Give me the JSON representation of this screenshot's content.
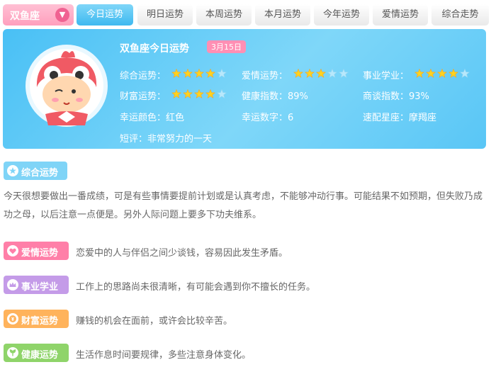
{
  "nav": {
    "sign": "双鱼座",
    "tabs": [
      "今日运势",
      "明日运势",
      "本周运势",
      "本月运势",
      "今年运势",
      "爱情运势",
      "综合走势"
    ]
  },
  "banner": {
    "title": "双鱼座今日运势",
    "date": "3月15日",
    "stats": {
      "overall": {
        "label": "综合运势：",
        "stars": 4
      },
      "love": {
        "label": "爱情运势：",
        "stars": 3
      },
      "career": {
        "label": "事业学业：",
        "stars": 4
      },
      "wealth": {
        "label": "财富运势：",
        "stars": 4
      },
      "health": "健康指数：89%",
      "negotiation": "商谈指数：93%",
      "color": "幸运颜色：红色",
      "number": "幸运数字：6",
      "match": "速配星座：摩羯座",
      "comment": "短评：非常努力的一天"
    }
  },
  "sections": {
    "overall": {
      "label": "综合运势",
      "text": "今天很想要做出一番成绩，可是有些事情要提前计划或是认真考虑，不能够冲动行事。可能结果不如预期，但失败乃成功之母，以后注意一点便是。另外人际问题上要多下功夫维系。"
    },
    "love": {
      "label": "爱情运势",
      "text": "恋爱中的人与伴侣之间少谈钱，容易因此发生矛盾。"
    },
    "career": {
      "label": "事业学业",
      "text": "工作上的思路尚未很清晰，有可能会遇到你不擅长的任务。"
    },
    "wealth": {
      "label": "财富运势",
      "text": "赚钱的机会在面前，或许会比较辛苦。"
    },
    "health": {
      "label": "健康运势",
      "text": "生活作息时间要规律，多些注意身体变化。"
    }
  },
  "colors": {
    "accent_blue": "#49c0f5",
    "love_pink": "#ff7fa8",
    "career_purple": "#c49be8",
    "wealth_orange": "#ffb35c",
    "health_green": "#8fd46a"
  }
}
